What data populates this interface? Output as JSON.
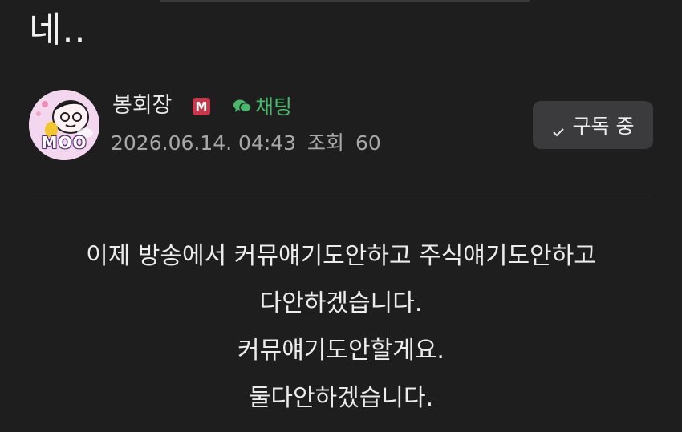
{
  "post": {
    "title": "네..",
    "author": {
      "name": "봉회장",
      "badge": "M",
      "avatar_text": "MOO",
      "chat_label": "채팅"
    },
    "meta": {
      "datetime": "2026.06.14. 04:43",
      "views_label": "조회",
      "views": "60"
    },
    "subscribe_label": "구독 중",
    "body_lines": [
      "이제 방송에서 커뮤얘기도안하고 주식얘기도안하고",
      "다안하겠습니다.",
      "커뮤얘기도안할게요.",
      "둘다안하겠습니다."
    ]
  },
  "colors": {
    "background": "#1e1e1f",
    "chat_green": "#49b86a",
    "badge_red": "#c9374d",
    "button_bg": "#3b3b3d",
    "avatar_bg": "#f3d7ef"
  },
  "icons": {
    "chat": "speech-bubbles-icon",
    "subscribe": "check-icon"
  }
}
